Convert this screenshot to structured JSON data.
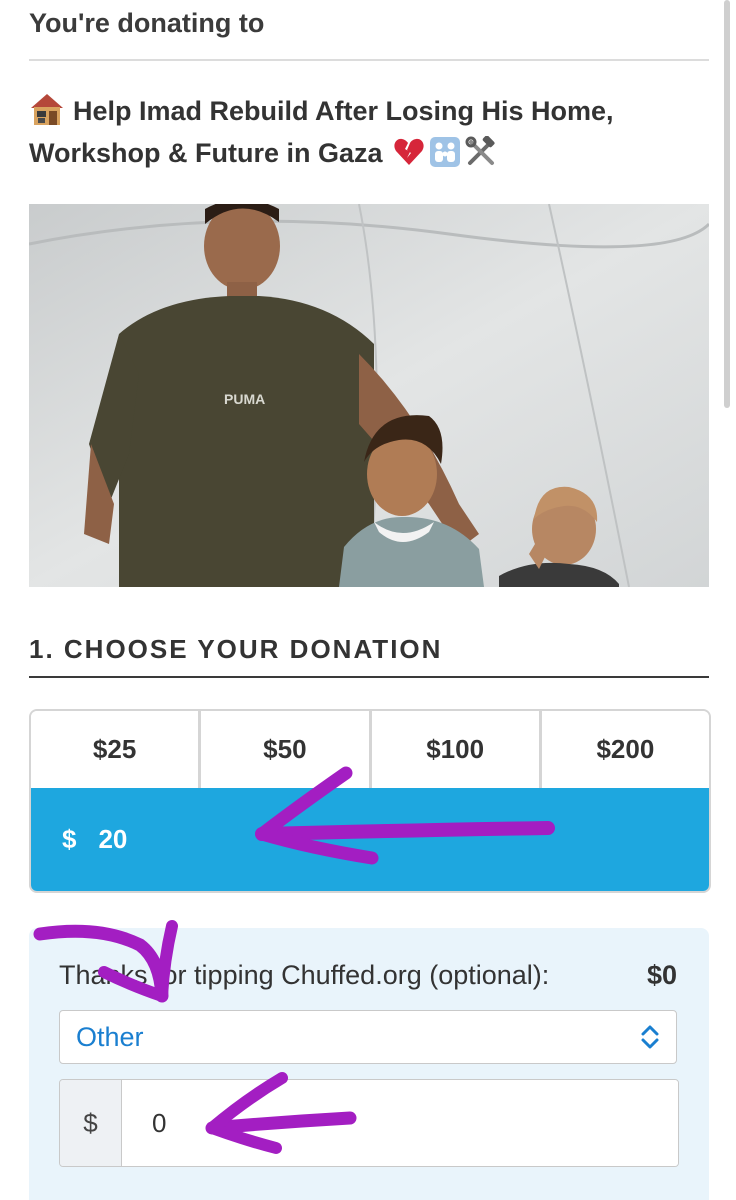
{
  "header": {
    "donating_to": "You're donating to"
  },
  "campaign": {
    "title_emoji_icon": "house-emoji-icon",
    "title": "Help Imad Rebuild After Losing His Home, Workshop & Future in Gaza",
    "trailing_emoji_icons": [
      "broken-heart-icon",
      "family-icon",
      "tools-icon"
    ],
    "photo_logo_text": "PUMA"
  },
  "donation": {
    "heading": "1. CHOOSE YOUR DONATION",
    "preset_amounts": [
      "$25",
      "$50",
      "$100",
      "$200"
    ],
    "custom_currency": "$",
    "custom_value": "20",
    "accent_color": "#1ea7df"
  },
  "tip": {
    "label": "Thanks for tipping Chuffed.org (optional):",
    "amount": "$0",
    "select_value": "Other",
    "input_currency": "$",
    "input_value": "0"
  },
  "annotations": {
    "arrow_color": "#a31ec2"
  }
}
